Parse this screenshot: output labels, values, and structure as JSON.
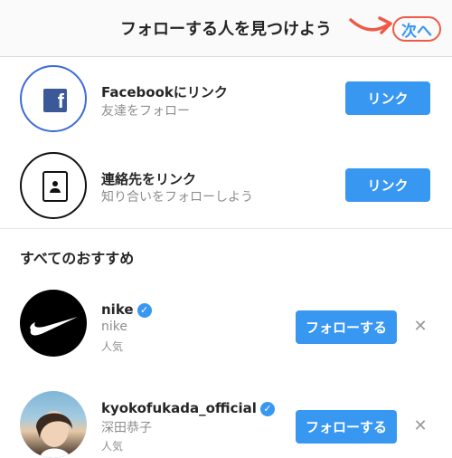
{
  "header": {
    "title": "フォローする人を見つけよう",
    "next_label": "次へ"
  },
  "links": [
    {
      "title": "Facebookにリンク",
      "subtitle": "友達をフォロー",
      "button": "リンク",
      "icon": "facebook-icon"
    },
    {
      "title": "連絡先をリンク",
      "subtitle": "知り合いをフォローしよう",
      "button": "リンク",
      "icon": "contacts-icon"
    }
  ],
  "suggestions": {
    "title": "すべてのおすすめ",
    "items": [
      {
        "username": "nike",
        "name": "nike",
        "meta": "人気",
        "verified": true,
        "button": "フォローする"
      },
      {
        "username": "kyokofukada_official",
        "name": "深田恭子",
        "meta": "人気",
        "verified": true,
        "button": "フォローする"
      }
    ]
  },
  "colors": {
    "accent": "#3897f0",
    "annotation": "#ef5a46",
    "facebook": "#3b5998"
  }
}
